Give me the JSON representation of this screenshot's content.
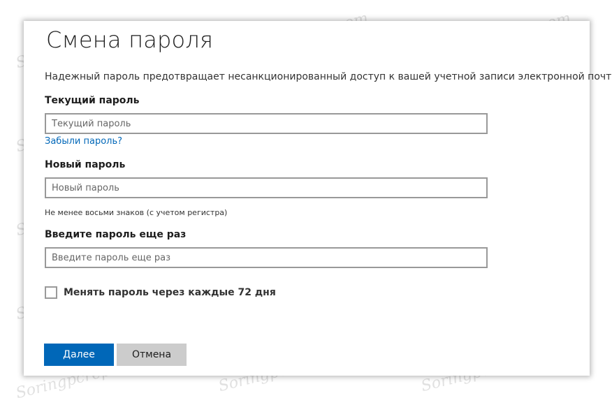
{
  "page": {
    "title": "Смена пароля",
    "description": "Надежный пароль предотвращает несанкционированный доступ к вашей учетной записи электронной почты."
  },
  "current_password": {
    "label": "Текущий пароль",
    "value": "",
    "placeholder": "Текущий пароль",
    "forgot_link": "Забыли пароль?"
  },
  "new_password": {
    "label": "Новый пароль",
    "value": "",
    "placeholder": "Новый пароль",
    "hint": "Не менее восьми знаков (с учетом регистра)"
  },
  "confirm_password": {
    "label": "Введите пароль еще раз",
    "value": "",
    "placeholder": "Введите пароль еще раз"
  },
  "rotate_option": {
    "label": "Менять пароль через каждые 72 дня",
    "checked": false
  },
  "buttons": {
    "next_label": "Далее",
    "cancel_label": "Отмена"
  },
  "watermark": {
    "text": "Soringpcrepair.com"
  },
  "colors": {
    "primary": "#0067b8",
    "secondary": "#cccccc",
    "border": "#999999",
    "link": "#0067b8"
  }
}
